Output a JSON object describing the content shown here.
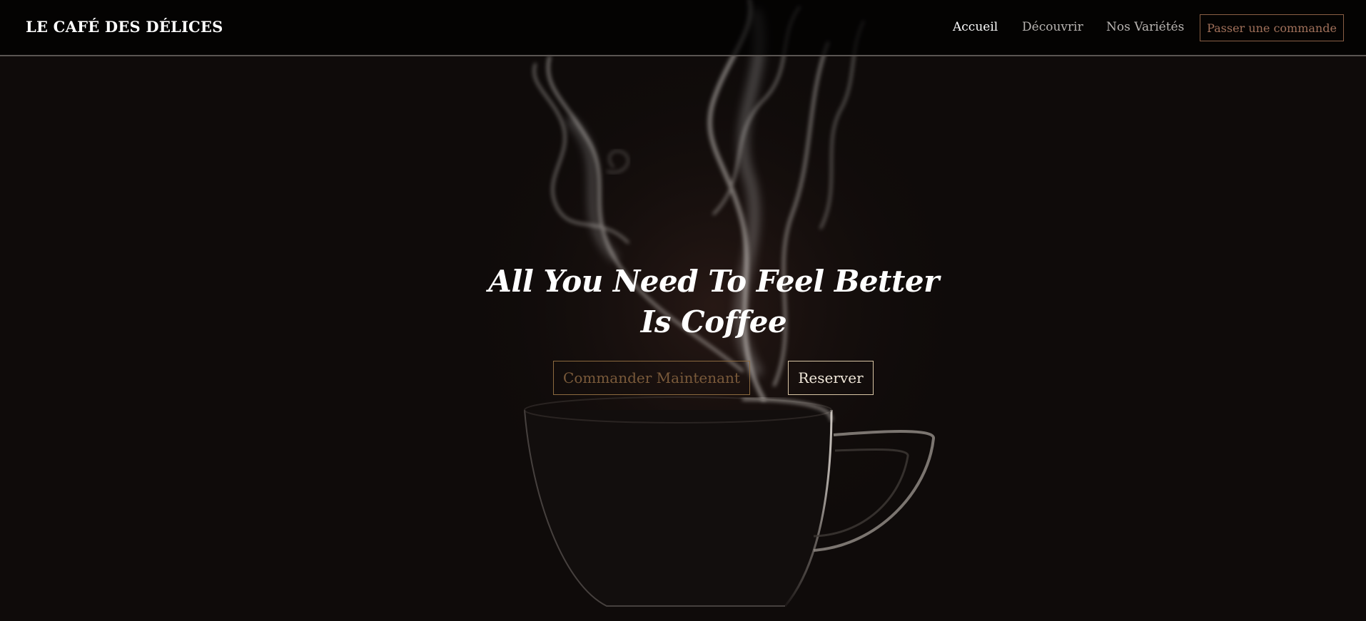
{
  "navbar": {
    "brand": "LE CAFÉ DES DÉLICES",
    "links": [
      {
        "label": "Accueil",
        "active": true
      },
      {
        "label": "Découvrir",
        "active": false
      },
      {
        "label": "Nos Variétés",
        "active": false
      }
    ],
    "cta_label": "Passer une commande"
  },
  "hero": {
    "headline_line1": "All You Need To Feel Better",
    "headline_line2": "Is Coffee",
    "order_button": "Commander Maintenant",
    "reserve_button": "Reserver"
  },
  "colors": {
    "background": "#0f0b0a",
    "accent": "#8a5f45",
    "text": "#ffffff"
  }
}
